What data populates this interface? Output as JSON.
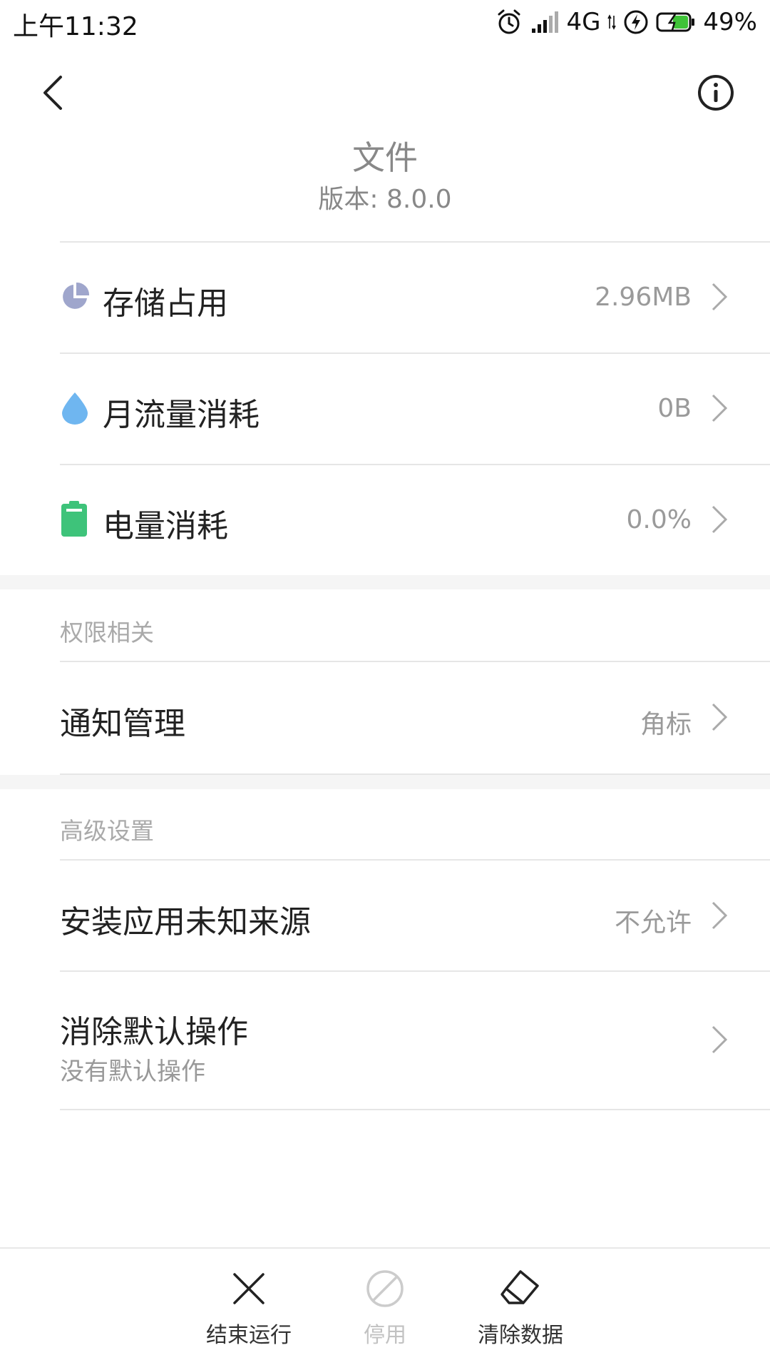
{
  "status_bar": {
    "time": "上午11:32",
    "network": "4G",
    "battery": "49%"
  },
  "header": {
    "app_name": "文件",
    "version": "版本: 8.0.0"
  },
  "usage_items": [
    {
      "label": "存储占用",
      "value": "2.96MB",
      "icon": "pie-chart-icon",
      "icon_color": "#9FA6CC"
    },
    {
      "label": "月流量消耗",
      "value": "0B",
      "icon": "water-drop-icon",
      "icon_color": "#6FB6F0"
    },
    {
      "label": "电量消耗",
      "value": "0.0%",
      "icon": "battery-icon",
      "icon_color": "#3EC37A"
    }
  ],
  "permissions": {
    "title": "权限相关",
    "items": [
      {
        "label": "通知管理",
        "value": "角标"
      }
    ]
  },
  "advanced": {
    "title": "高级设置",
    "items": [
      {
        "label": "安装应用未知来源",
        "value": "不允许"
      },
      {
        "label": "消除默认操作",
        "sublabel": "没有默认操作"
      }
    ]
  },
  "bottom_actions": [
    {
      "label": "结束运行",
      "icon": "close-x-icon",
      "enabled": true
    },
    {
      "label": "停用",
      "icon": "disable-circle-icon",
      "enabled": false
    },
    {
      "label": "清除数据",
      "icon": "eraser-icon",
      "enabled": true
    }
  ]
}
